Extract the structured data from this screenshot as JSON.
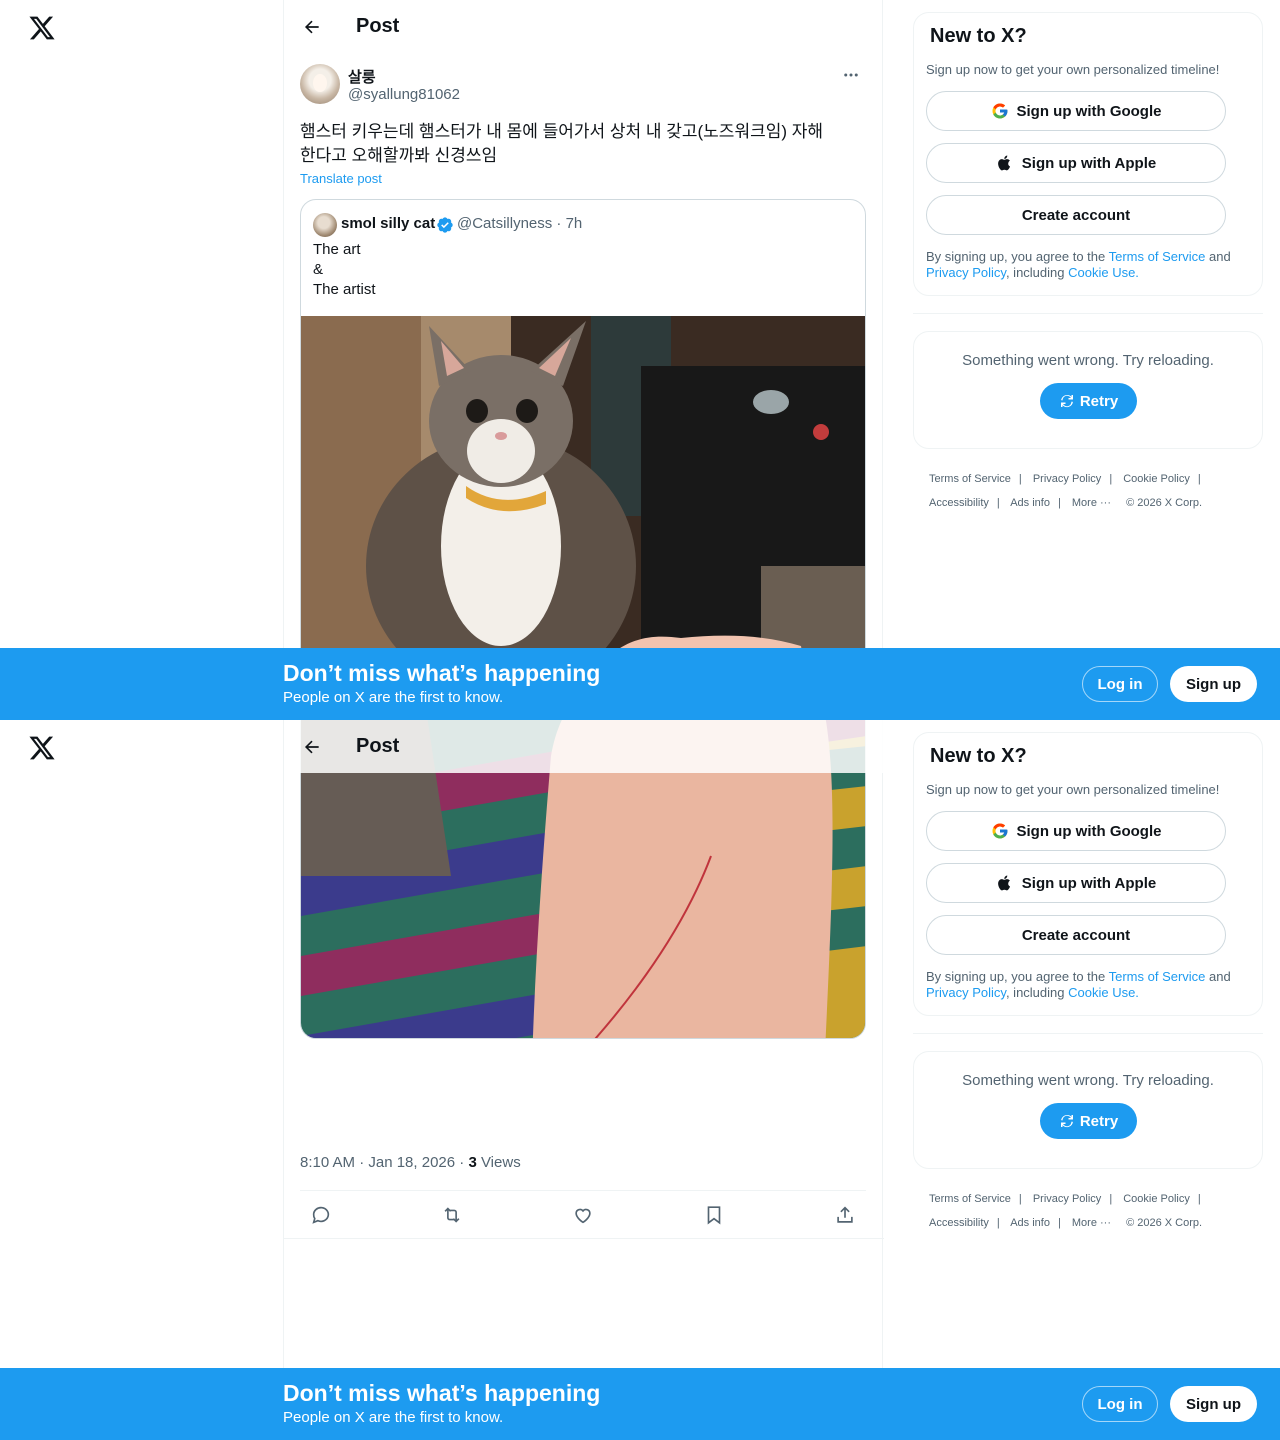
{
  "header": {
    "title": "Post"
  },
  "post": {
    "author": {
      "display_name": "살룽",
      "handle": "@syallung81062"
    },
    "text_line1": "햄스터 키우는데 햄스터가 내 몸에 들어가서 상처 내 갖고(노즈워크임) 자해",
    "text_line2": "한다고 오해할까봐 신경쓰임",
    "translate_label": "Translate post",
    "timestamp": "8:10 AM · Jan 18, 2026 · ",
    "views_count": "3",
    "views_label": " Views",
    "quote": {
      "display_name": "smol silly cat",
      "handle_time": "@Catsillyness · 7h",
      "lines": [
        "The art",
        "&",
        "The artist"
      ]
    }
  },
  "sidebar": {
    "title": "New to X?",
    "subtitle": "Sign up now to get your own personalized timeline!",
    "google_label": "Sign up with Google",
    "apple_label": "Sign up with Apple",
    "create_label": "Create account",
    "legal_prefix": "By signing up, you agree to the ",
    "legal_terms": "Terms of Service",
    "legal_and": " and",
    "legal_privacy": "Privacy Policy",
    "legal_including": ", including ",
    "legal_cookie": "Cookie Use.",
    "error_text": "Something went wrong. Try reloading.",
    "retry_label": "Retry"
  },
  "footer": {
    "terms": "Terms of Service",
    "privacy": "Privacy Policy",
    "cookie": "Cookie Policy",
    "accessibility": "Accessibility",
    "ads": "Ads info",
    "more": "More ···",
    "copyright": "© 2026 X Corp."
  },
  "banner": {
    "title": "Don’t miss what’s happening",
    "subtitle": "People on X are the first to know.",
    "login_label": "Log in",
    "signup_label": "Sign up"
  },
  "colors": {
    "accent": "#1d9bf0",
    "text": "#0f1419",
    "secondary": "#536471",
    "border": "#cfd9de"
  }
}
